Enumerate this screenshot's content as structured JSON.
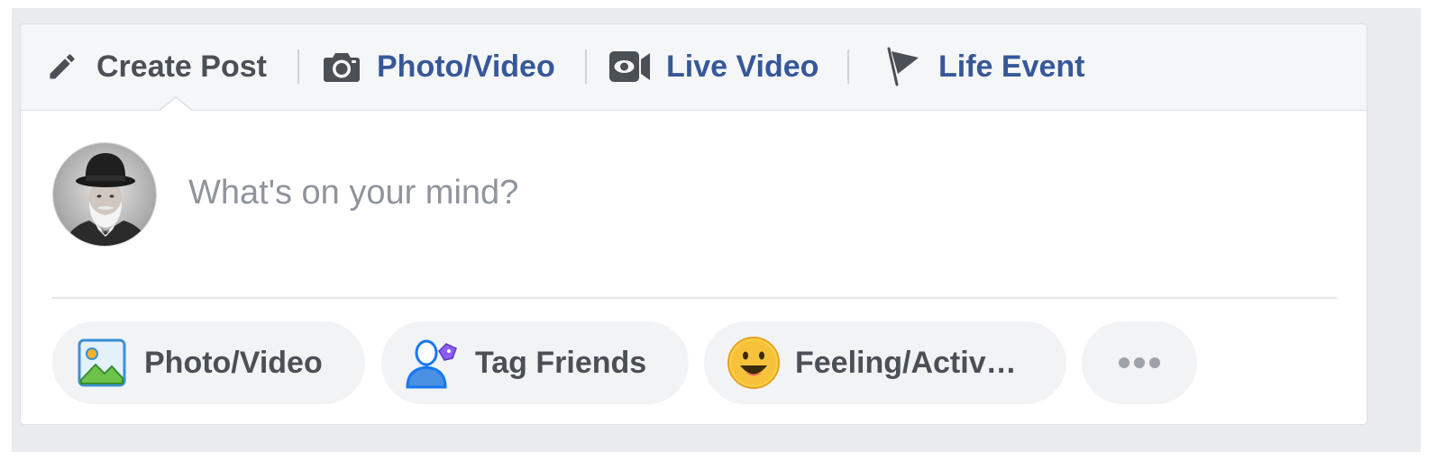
{
  "composer": {
    "tabs": [
      {
        "label": "Create Post",
        "icon": "pencil-icon",
        "active": true
      },
      {
        "label": "Photo/Video",
        "icon": "camera-icon"
      },
      {
        "label": "Live Video",
        "icon": "video-camera-icon"
      },
      {
        "label": "Life Event",
        "icon": "flag-icon"
      }
    ],
    "placeholder": "What's on your mind?",
    "value": "",
    "avatar": {
      "icon": "user-avatar"
    },
    "actions": [
      {
        "label": "Photo/Video",
        "icon": "photo-icon"
      },
      {
        "label": "Tag Friends",
        "icon": "tag-friends-icon"
      },
      {
        "label": "Feeling/Activ…",
        "icon": "smiley-icon"
      },
      {
        "label": "",
        "icon": "more-icon"
      }
    ]
  },
  "colors": {
    "link_blue": "#365899",
    "text_dark": "#4b4f56",
    "placeholder_gray": "#90949c",
    "page_background": "#e9ebee",
    "pill_background": "#f2f3f5",
    "photo_icon_green": "#4caf50",
    "tag_icon_blue": "#1877f2",
    "tag_icon_purple": "#8b5cf6",
    "smiley_yellow": "#f7b125"
  }
}
